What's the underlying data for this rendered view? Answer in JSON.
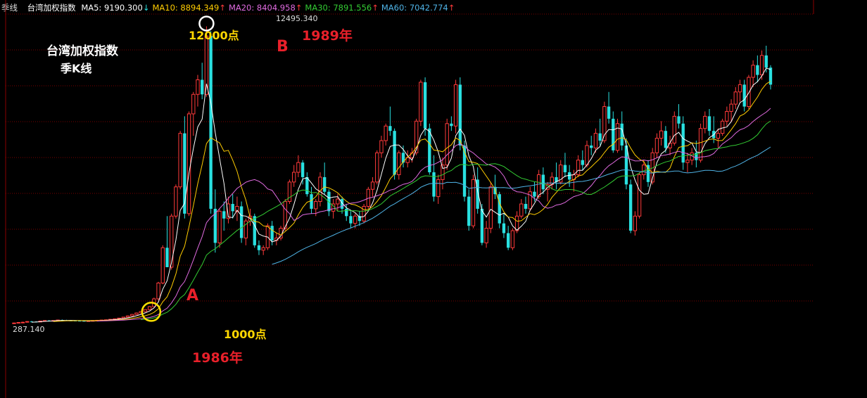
{
  "header": {
    "period": "季线",
    "instrument": "台湾加权指数",
    "ma": [
      {
        "label": "MA5: 9190.300",
        "arrow": "↓",
        "color": "#ffffff",
        "arrow_color": "#29e0e0"
      },
      {
        "label": "MA10: 8894.349",
        "arrow": "↑",
        "color": "#ffcc00",
        "arrow_color": "#ff3a3a"
      },
      {
        "label": "MA20: 8404.958",
        "arrow": "↑",
        "color": "#e06be0",
        "arrow_color": "#ff3a3a"
      },
      {
        "label": "MA30: 7891.556",
        "arrow": "↑",
        "color": "#33cc33",
        "arrow_color": "#ff3a3a"
      },
      {
        "label": "MA60: 7042.774",
        "arrow": "↑",
        "color": "#4fb3e6",
        "arrow_color": "#ff3a3a"
      }
    ]
  },
  "annotations": {
    "title": "台湾加权指数",
    "subtitle": "季K线",
    "point_a": "A",
    "point_b": "B",
    "year_a": "1986年",
    "year_b": "1989年",
    "level_a": "1000点",
    "level_b": "12000点",
    "peak_value": "12495.340",
    "low_value": "287.140"
  },
  "colors": {
    "up": "#ff3a3a",
    "down": "#29e0e0",
    "grid": "#7a0000",
    "circle_a": "#ffe100",
    "circle_b": "#ffffff",
    "annotation_red": "#e8202a",
    "annotation_yellow": "#ffd700",
    "annotation_white": "#ffffff"
  },
  "chart_data": {
    "type": "candlestick",
    "period": "quarterly",
    "ylim": [
      0,
      13000
    ],
    "series": [
      {
        "name": "MA5",
        "color": "#ffffff"
      },
      {
        "name": "MA10",
        "color": "#ffcc00"
      },
      {
        "name": "MA20",
        "color": "#e06be0"
      },
      {
        "name": "MA30",
        "color": "#33cc33"
      },
      {
        "name": "MA60",
        "color": "#4fb3e6"
      }
    ],
    "key_points": [
      {
        "label": "A",
        "year": "1986年",
        "value": 1000
      },
      {
        "label": "B",
        "year": "1989年",
        "value": 12495.34
      }
    ],
    "candles": [
      [
        287,
        320,
        280,
        310
      ],
      [
        310,
        340,
        300,
        330
      ],
      [
        330,
        360,
        320,
        340
      ],
      [
        340,
        380,
        330,
        370
      ],
      [
        370,
        390,
        350,
        360
      ],
      [
        360,
        380,
        340,
        350
      ],
      [
        350,
        400,
        345,
        390
      ],
      [
        390,
        420,
        380,
        410
      ],
      [
        410,
        430,
        395,
        400
      ],
      [
        400,
        420,
        390,
        410
      ],
      [
        410,
        440,
        400,
        430
      ],
      [
        430,
        450,
        410,
        420
      ],
      [
        420,
        440,
        400,
        410
      ],
      [
        410,
        430,
        395,
        405
      ],
      [
        405,
        420,
        390,
        400
      ],
      [
        400,
        420,
        385,
        395
      ],
      [
        395,
        410,
        380,
        390
      ],
      [
        390,
        410,
        380,
        400
      ],
      [
        400,
        420,
        390,
        410
      ],
      [
        410,
        430,
        400,
        420
      ],
      [
        420,
        440,
        410,
        430
      ],
      [
        430,
        450,
        420,
        440
      ],
      [
        440,
        470,
        430,
        460
      ],
      [
        460,
        490,
        450,
        480
      ],
      [
        480,
        520,
        470,
        510
      ],
      [
        510,
        560,
        500,
        550
      ],
      [
        550,
        620,
        540,
        600
      ],
      [
        600,
        680,
        590,
        660
      ],
      [
        660,
        740,
        640,
        720
      ],
      [
        720,
        800,
        700,
        780
      ],
      [
        780,
        880,
        760,
        860
      ],
      [
        860,
        1000,
        840,
        980
      ],
      [
        980,
        1350,
        970,
        1300
      ],
      [
        1300,
        2000,
        1250,
        1950
      ],
      [
        1950,
        3500,
        1900,
        3400
      ],
      [
        3400,
        4700,
        3200,
        2600
      ],
      [
        2600,
        4800,
        2500,
        4700
      ],
      [
        4700,
        6000,
        4600,
        5900
      ],
      [
        5900,
        8200,
        5800,
        8100
      ],
      [
        8100,
        8800,
        4600,
        4800
      ],
      [
        4800,
        9000,
        4700,
        8900
      ],
      [
        8900,
        9800,
        8000,
        9700
      ],
      [
        9700,
        10500,
        9200,
        10300
      ],
      [
        10300,
        11000,
        9500,
        9700
      ],
      [
        9700,
        12495,
        9600,
        12100
      ],
      [
        12100,
        12300,
        4800,
        5000
      ],
      [
        5000,
        5800,
        3200,
        3600
      ],
      [
        3600,
        5000,
        3400,
        4900
      ],
      [
        4900,
        5300,
        4100,
        4600
      ],
      [
        4600,
        5500,
        4400,
        5200
      ],
      [
        5200,
        5600,
        4600,
        4900
      ],
      [
        4900,
        5500,
        4500,
        5100
      ],
      [
        5100,
        5300,
        3600,
        3800
      ],
      [
        3800,
        4600,
        3500,
        4500
      ],
      [
        4500,
        5000,
        4300,
        4700
      ],
      [
        4700,
        4800,
        3400,
        3500
      ],
      [
        3500,
        3700,
        3100,
        3300
      ],
      [
        3300,
        3500,
        3100,
        3400
      ],
      [
        3400,
        4400,
        3300,
        4300
      ],
      [
        4300,
        4500,
        3500,
        3700
      ],
      [
        3700,
        4000,
        3500,
        3800
      ],
      [
        3800,
        4300,
        3700,
        4200
      ],
      [
        4200,
        5400,
        4100,
        5300
      ],
      [
        5300,
        6200,
        5200,
        6100
      ],
      [
        6100,
        6800,
        5900,
        6500
      ],
      [
        6500,
        7200,
        6300,
        6900
      ],
      [
        6900,
        7000,
        6000,
        6300
      ],
      [
        6300,
        6500,
        5500,
        5600
      ],
      [
        5600,
        5900,
        4800,
        5000
      ],
      [
        5000,
        5400,
        4700,
        5300
      ],
      [
        5300,
        6500,
        5100,
        6300
      ],
      [
        6300,
        6900,
        5600,
        5700
      ],
      [
        5700,
        5800,
        4700,
        4900
      ],
      [
        4900,
        5400,
        4600,
        5200
      ],
      [
        5200,
        5600,
        4900,
        5400
      ],
      [
        5400,
        5500,
        4800,
        5000
      ],
      [
        5000,
        5200,
        4500,
        4700
      ],
      [
        4700,
        4900,
        4200,
        4400
      ],
      [
        4400,
        4800,
        4200,
        4700
      ],
      [
        4700,
        4900,
        4300,
        4500
      ],
      [
        4500,
        5200,
        4400,
        5100
      ],
      [
        5100,
        5900,
        5000,
        5800
      ],
      [
        5800,
        6300,
        5500,
        6100
      ],
      [
        6100,
        7400,
        6000,
        7300
      ],
      [
        7300,
        8000,
        7100,
        7800
      ],
      [
        7800,
        8500,
        7600,
        8400
      ],
      [
        8400,
        9200,
        8000,
        8200
      ],
      [
        8200,
        8300,
        6200,
        6400
      ],
      [
        6400,
        7400,
        6200,
        7300
      ],
      [
        7300,
        7600,
        6700,
        6900
      ],
      [
        6900,
        7400,
        6700,
        7100
      ],
      [
        7100,
        7500,
        6900,
        7300
      ],
      [
        7300,
        8700,
        7200,
        8600
      ],
      [
        8600,
        10300,
        8400,
        10200
      ],
      [
        10200,
        10400,
        8000,
        8300
      ],
      [
        8300,
        8500,
        6400,
        6500
      ],
      [
        6500,
        7200,
        5300,
        5500
      ],
      [
        5500,
        6400,
        5200,
        6200
      ],
      [
        6200,
        7100,
        5800,
        6800
      ],
      [
        6800,
        8700,
        6600,
        8500
      ],
      [
        8500,
        8800,
        8200,
        8400
      ],
      [
        8400,
        10300,
        8100,
        10100
      ],
      [
        10100,
        10400,
        7400,
        7600
      ],
      [
        7600,
        7800,
        5300,
        5500
      ],
      [
        5500,
        5800,
        4100,
        4300
      ],
      [
        4300,
        6400,
        4200,
        6200
      ],
      [
        6200,
        6700,
        4800,
        5000
      ],
      [
        5000,
        5200,
        3500,
        3600
      ],
      [
        3600,
        4500,
        3400,
        4200
      ],
      [
        4200,
        6100,
        4000,
        5900
      ],
      [
        5900,
        6400,
        5400,
        5600
      ],
      [
        5600,
        5700,
        4200,
        4400
      ],
      [
        4400,
        4800,
        3800,
        4000
      ],
      [
        4000,
        4300,
        3300,
        3400
      ],
      [
        3400,
        4200,
        3300,
        4100
      ],
      [
        4100,
        4900,
        4000,
        4700
      ],
      [
        4700,
        5400,
        4600,
        5200
      ],
      [
        5200,
        5500,
        4800,
        5000
      ],
      [
        5000,
        5900,
        4900,
        5700
      ],
      [
        5700,
        6100,
        5300,
        5500
      ],
      [
        5500,
        6600,
        5400,
        6400
      ],
      [
        6400,
        6700,
        5600,
        5800
      ],
      [
        5800,
        6100,
        5300,
        6000
      ],
      [
        6000,
        6500,
        5800,
        6300
      ],
      [
        6300,
        6900,
        5800,
        6100
      ],
      [
        6100,
        7000,
        6000,
        6800
      ],
      [
        6800,
        7300,
        6300,
        6500
      ],
      [
        6500,
        6800,
        5900,
        6200
      ],
      [
        6200,
        6600,
        5700,
        6400
      ],
      [
        6400,
        7200,
        6300,
        7000
      ],
      [
        7000,
        7400,
        6600,
        6800
      ],
      [
        6800,
        7800,
        6700,
        7600
      ],
      [
        7600,
        8000,
        7200,
        7500
      ],
      [
        7500,
        8300,
        7300,
        8100
      ],
      [
        8100,
        8700,
        7600,
        7800
      ],
      [
        7800,
        9400,
        7700,
        9200
      ],
      [
        9200,
        9800,
        8500,
        8700
      ],
      [
        8700,
        9000,
        7300,
        7400
      ],
      [
        7400,
        8700,
        7300,
        8500
      ],
      [
        8500,
        9000,
        7400,
        7600
      ],
      [
        7600,
        7900,
        5800,
        6000
      ],
      [
        6000,
        6200,
        4000,
        4100
      ],
      [
        4100,
        4900,
        3900,
        4700
      ],
      [
        4700,
        6500,
        4600,
        6400
      ],
      [
        6400,
        7000,
        6200,
        6800
      ],
      [
        6800,
        7000,
        5900,
        6100
      ],
      [
        6100,
        7500,
        6000,
        7300
      ],
      [
        7300,
        8100,
        7100,
        7900
      ],
      [
        7900,
        8600,
        7600,
        8200
      ],
      [
        8200,
        8400,
        7300,
        7500
      ],
      [
        7500,
        8000,
        7200,
        7700
      ],
      [
        7700,
        9000,
        7600,
        8800
      ],
      [
        8800,
        9300,
        8300,
        8500
      ],
      [
        8500,
        8800,
        6600,
        6900
      ],
      [
        6900,
        7300,
        6500,
        7000
      ],
      [
        7000,
        7500,
        6800,
        7300
      ],
      [
        7300,
        7800,
        6700,
        7000
      ],
      [
        7000,
        8500,
        6900,
        8300
      ],
      [
        8300,
        9000,
        8100,
        8800
      ],
      [
        8800,
        9100,
        8000,
        8200
      ],
      [
        8200,
        8800,
        7700,
        7900
      ],
      [
        7900,
        8300,
        7500,
        8100
      ],
      [
        8100,
        8700,
        8000,
        8600
      ],
      [
        8600,
        9200,
        8400,
        9000
      ],
      [
        9000,
        9500,
        8600,
        9300
      ],
      [
        9300,
        10000,
        9100,
        9800
      ],
      [
        9800,
        10300,
        9400,
        10100
      ],
      [
        10100,
        10300,
        9000,
        9200
      ],
      [
        9200,
        10500,
        9100,
        10400
      ],
      [
        10400,
        11100,
        10000,
        10900
      ],
      [
        10900,
        11300,
        10200,
        10500
      ],
      [
        10500,
        11500,
        10300,
        11300
      ],
      [
        11300,
        11700,
        10600,
        10800
      ],
      [
        10800,
        10900,
        9900,
        10100
      ]
    ]
  }
}
